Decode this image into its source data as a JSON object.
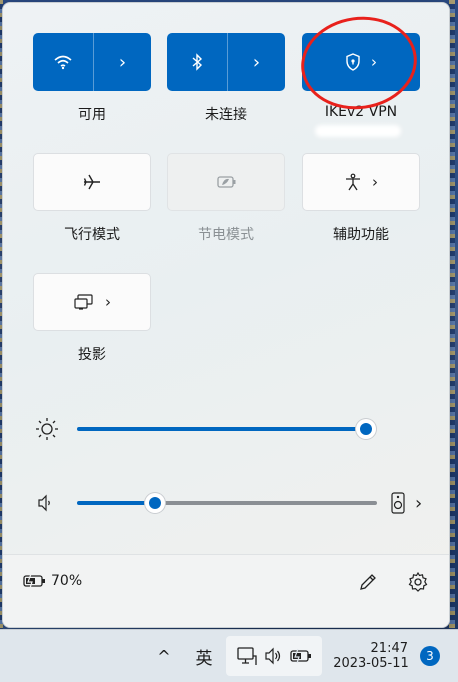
{
  "tiles": {
    "wifi": {
      "label": "可用"
    },
    "bluetooth": {
      "label": "未连接"
    },
    "vpn": {
      "label": "IKEv2 VPN"
    },
    "airplane": {
      "label": "飞行模式"
    },
    "battery_saver": {
      "label": "节电模式"
    },
    "accessibility": {
      "label": "辅助功能"
    },
    "cast": {
      "label": "投影"
    }
  },
  "brightness": {
    "value_percent": 100
  },
  "volume": {
    "value_percent": 25
  },
  "footer": {
    "battery_text": "70%"
  },
  "taskbar": {
    "chevron": "^",
    "ime": "英",
    "time": "21:47",
    "date": "2023-05-11",
    "notification_count": "3"
  },
  "colors": {
    "accent": "#0067c0",
    "annotation": "#e8211c"
  }
}
